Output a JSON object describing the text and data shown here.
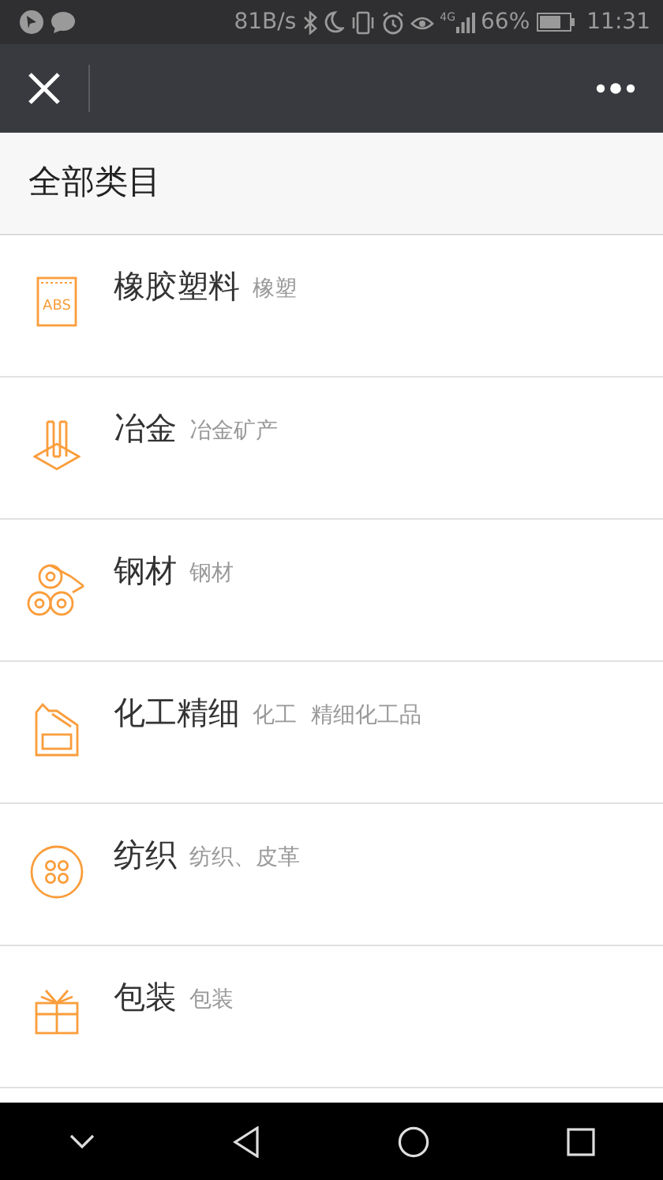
{
  "status_bar": {
    "network_speed": "81B/s",
    "network_type": "4G",
    "battery": "66%",
    "time": "11:31"
  },
  "header": {
    "title": "全部类目"
  },
  "categories": [
    {
      "kind": "abs",
      "icon_label": "ABS",
      "title": "橡胶塑料",
      "subtitle": "橡塑"
    },
    {
      "kind": "beam",
      "title": "冶金",
      "subtitle": "冶金矿产"
    },
    {
      "kind": "pipes",
      "title": "钢材",
      "subtitle": "钢材"
    },
    {
      "kind": "canister",
      "title": "化工精细",
      "subtitle": "化工  精细化工品"
    },
    {
      "kind": "button",
      "title": "纺织",
      "subtitle": "纺织、皮革"
    },
    {
      "kind": "gift",
      "title": "包装",
      "subtitle": "包装"
    }
  ]
}
